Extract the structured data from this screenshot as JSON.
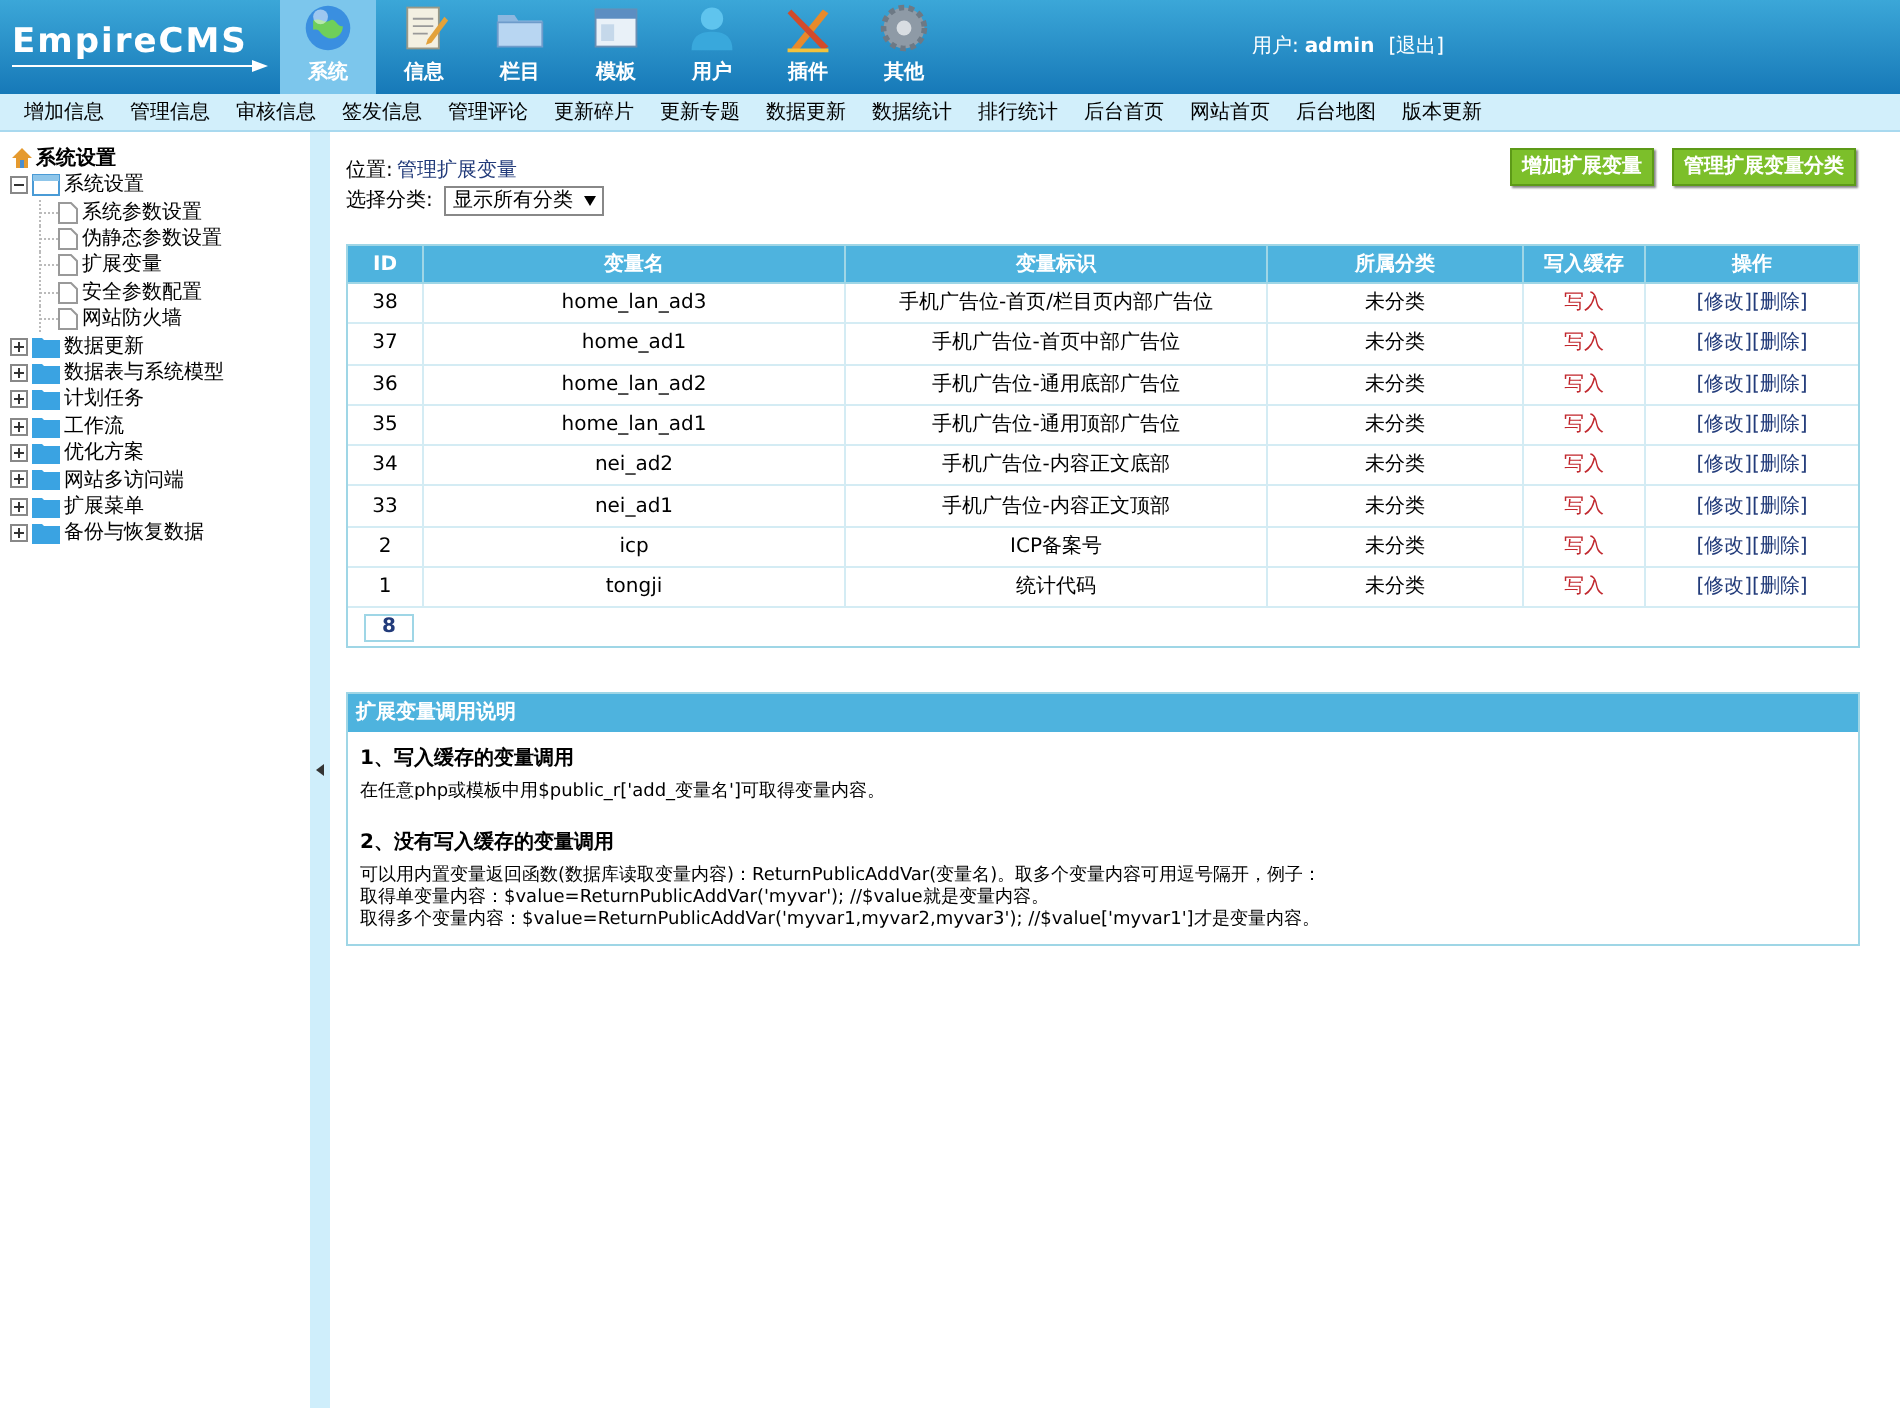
{
  "header": {
    "logo": "EmpireCMS",
    "nav": [
      {
        "label": "系统",
        "selected": true
      },
      {
        "label": "信息",
        "selected": false
      },
      {
        "label": "栏目",
        "selected": false
      },
      {
        "label": "模板",
        "selected": false
      },
      {
        "label": "用户",
        "selected": false
      },
      {
        "label": "插件",
        "selected": false
      },
      {
        "label": "其他",
        "selected": false
      }
    ],
    "user_label": "用户:",
    "user": "admin",
    "logout": "[退出]"
  },
  "menu": [
    "增加信息",
    "管理信息",
    "审核信息",
    "签发信息",
    "管理评论",
    "更新碎片",
    "更新专题",
    "数据更新",
    "数据统计",
    "排行统计",
    "后台首页",
    "网站首页",
    "后台地图",
    "版本更新"
  ],
  "sidebar": {
    "title": "系统设置",
    "tree": [
      {
        "label": "系统设置",
        "expanded": true,
        "children": [
          {
            "label": "系统参数设置"
          },
          {
            "label": "伪静态参数设置"
          },
          {
            "label": "扩展变量"
          },
          {
            "label": "安全参数配置"
          },
          {
            "label": "网站防火墙"
          }
        ]
      },
      {
        "label": "数据更新",
        "expanded": false
      },
      {
        "label": "数据表与系统模型",
        "expanded": false
      },
      {
        "label": "计划任务",
        "expanded": false
      },
      {
        "label": "工作流",
        "expanded": false
      },
      {
        "label": "优化方案",
        "expanded": false
      },
      {
        "label": "网站多访问端",
        "expanded": false
      },
      {
        "label": "扩展菜单",
        "expanded": false
      },
      {
        "label": "备份与恢复数据",
        "expanded": false
      }
    ]
  },
  "location": {
    "label": "位置:",
    "link": "管理扩展变量"
  },
  "buttons": [
    "增加扩展变量",
    "管理扩展变量分类"
  ],
  "filter": {
    "label": "选择分类:",
    "value": "显示所有分类"
  },
  "table": {
    "columns": [
      "ID",
      "变量名",
      "变量标识",
      "所属分类",
      "写入缓存",
      "操作"
    ],
    "rows": [
      {
        "id": "38",
        "name": "home_lan_ad3",
        "mark": "手机广告位-首页/栏目页内部广告位",
        "category": "未分类",
        "cache": "写入",
        "edit": "[修改]",
        "delete": "[删除]"
      },
      {
        "id": "37",
        "name": "home_ad1",
        "mark": "手机广告位-首页中部广告位",
        "category": "未分类",
        "cache": "写入",
        "edit": "[修改]",
        "delete": "[删除]"
      },
      {
        "id": "36",
        "name": "home_lan_ad2",
        "mark": "手机广告位-通用底部广告位",
        "category": "未分类",
        "cache": "写入",
        "edit": "[修改]",
        "delete": "[删除]"
      },
      {
        "id": "35",
        "name": "home_lan_ad1",
        "mark": "手机广告位-通用顶部广告位",
        "category": "未分类",
        "cache": "写入",
        "edit": "[修改]",
        "delete": "[删除]"
      },
      {
        "id": "34",
        "name": "nei_ad2",
        "mark": "手机广告位-内容正文底部",
        "category": "未分类",
        "cache": "写入",
        "edit": "[修改]",
        "delete": "[删除]"
      },
      {
        "id": "33",
        "name": "nei_ad1",
        "mark": "手机广告位-内容正文顶部",
        "category": "未分类",
        "cache": "写入",
        "edit": "[修改]",
        "delete": "[删除]"
      },
      {
        "id": "2",
        "name": "icp",
        "mark": "ICP备案号",
        "category": "未分类",
        "cache": "写入",
        "edit": "[修改]",
        "delete": "[删除]"
      },
      {
        "id": "1",
        "name": "tongji",
        "mark": "统计代码",
        "category": "未分类",
        "cache": "写入",
        "edit": "[修改]",
        "delete": "[删除]"
      }
    ],
    "page": "8"
  },
  "help": {
    "title": "扩展变量调用说明",
    "sections": [
      {
        "heading": "1、写入缓存的变量调用",
        "lines": [
          "在任意php或模板中用$public_r['add_变量名']可取得变量内容。"
        ]
      },
      {
        "heading": "2、没有写入缓存的变量调用",
        "lines": [
          "可以用内置变量返回函数(数据库读取变量内容)：ReturnPublicAddVar(变量名)。取多个变量内容可用逗号隔开，例子：",
          "取得单变量内容：$value=ReturnPublicAddVar('myvar'); //$value就是变量内容。",
          "取得多个变量内容：$value=ReturnPublicAddVar('myvar1,myvar2,myvar3'); //$value['myvar1']才是变量内容。"
        ]
      }
    ]
  }
}
